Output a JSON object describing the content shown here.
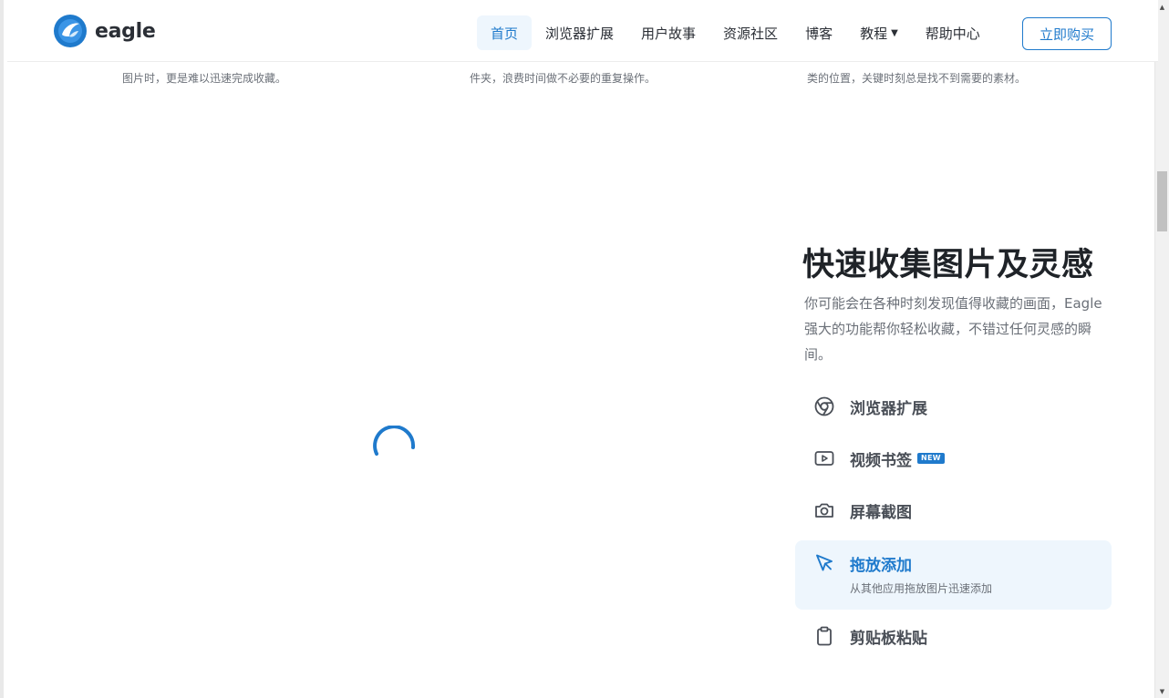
{
  "header": {
    "logo_text": "eagle",
    "nav": [
      {
        "label": "首页",
        "active": true
      },
      {
        "label": "浏览器扩展"
      },
      {
        "label": "用户故事"
      },
      {
        "label": "资源社区"
      },
      {
        "label": "博客"
      },
      {
        "label": "教程"
      },
      {
        "label": "帮助中心"
      }
    ],
    "buy_label": "立即购买"
  },
  "cut_row": [
    "图片时，更是难以迅速完成收藏。",
    "件夹，浪费时间做不必要的重复操作。",
    "类的位置，关键时刻总是找不到需要的素材。"
  ],
  "feature": {
    "title": "快速收集图片及灵感",
    "desc": "你可能会在各种时刻发现值得收藏的画面，Eagle 强大的功能帮你轻松收藏，不错过任何灵感的瞬间。",
    "items": [
      {
        "label": "浏览器扩展",
        "icon": "chrome-icon"
      },
      {
        "label": "视频书签",
        "icon": "video-play-icon",
        "badge": "NEW"
      },
      {
        "label": "屏幕截图",
        "icon": "camera-icon"
      },
      {
        "label": "拖放添加",
        "icon": "cursor-arrow-icon",
        "active": true,
        "sub": "从其他应用拖放图片迅速添加"
      },
      {
        "label": "剪贴板粘贴",
        "icon": "clipboard-icon"
      }
    ]
  },
  "colors": {
    "accent": "#1f7acc",
    "active_bg": "#eef6fd",
    "text": "#1f2328",
    "muted": "#6b7078"
  }
}
